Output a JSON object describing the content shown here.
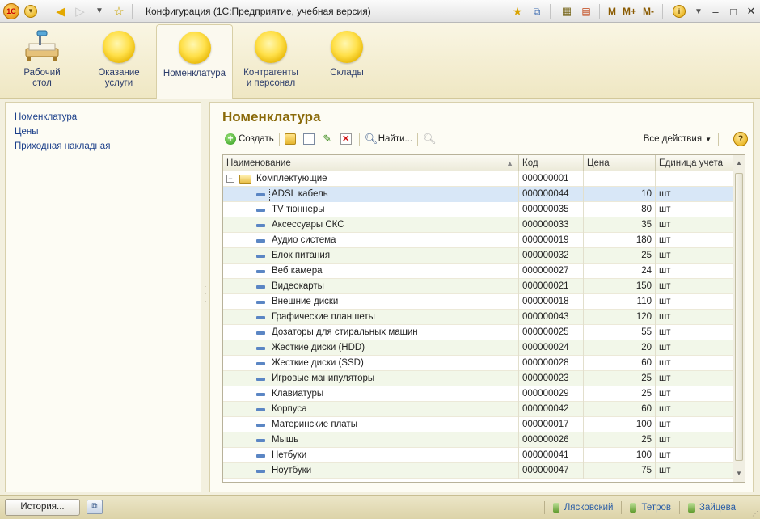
{
  "window": {
    "title": "Конфигурация  (1С:Предприятие, учебная версия)",
    "memory_buttons": [
      "M",
      "M+",
      "M-"
    ]
  },
  "sections": [
    {
      "label_line1": "Рабочий",
      "label_line2": "стол",
      "icon": "desktop-icon"
    },
    {
      "label_line1": "Оказание",
      "label_line2": "услуги",
      "icon": "section-icon"
    },
    {
      "label_line1": "Номенклатура",
      "label_line2": "",
      "icon": "section-icon",
      "active": true
    },
    {
      "label_line1": "Контрагенты",
      "label_line2": "и персонал",
      "icon": "section-icon"
    },
    {
      "label_line1": "Склады",
      "label_line2": "",
      "icon": "section-icon"
    }
  ],
  "leftnav": {
    "items": [
      "Номенклатура",
      "Цены",
      "Приходная накладная"
    ]
  },
  "main": {
    "title": "Номенклатура",
    "toolbar": {
      "create_label": "Создать",
      "find_label": "Найти...",
      "all_actions_label": "Все действия",
      "help_label": "?"
    },
    "columns": [
      "Наименование",
      "Код",
      "Цена",
      "Единица учета"
    ],
    "group_row": {
      "name": "Комплектующие",
      "code": "000000001",
      "price": "",
      "unit": ""
    },
    "rows": [
      {
        "name": "ADSL кабель",
        "code": "000000044",
        "price": "10",
        "unit": "шт"
      },
      {
        "name": "TV тюннеры",
        "code": "000000035",
        "price": "80",
        "unit": "шт"
      },
      {
        "name": "Аксессуары СКС",
        "code": "000000033",
        "price": "35",
        "unit": "шт"
      },
      {
        "name": "Аудио система",
        "code": "000000019",
        "price": "180",
        "unit": "шт"
      },
      {
        "name": "Блок питания",
        "code": "000000032",
        "price": "25",
        "unit": "шт"
      },
      {
        "name": "Веб камера",
        "code": "000000027",
        "price": "24",
        "unit": "шт"
      },
      {
        "name": "Видеокарты",
        "code": "000000021",
        "price": "150",
        "unit": "шт"
      },
      {
        "name": "Внешние диски",
        "code": "000000018",
        "price": "110",
        "unit": "шт"
      },
      {
        "name": "Графические планшеты",
        "code": "000000043",
        "price": "120",
        "unit": "шт"
      },
      {
        "name": "Дозаторы для стиральных машин",
        "code": "000000025",
        "price": "55",
        "unit": "шт"
      },
      {
        "name": "Жесткие диски (HDD)",
        "code": "000000024",
        "price": "20",
        "unit": "шт"
      },
      {
        "name": "Жесткие диски (SSD)",
        "code": "000000028",
        "price": "60",
        "unit": "шт"
      },
      {
        "name": "Игровые манипуляторы",
        "code": "000000023",
        "price": "25",
        "unit": "шт"
      },
      {
        "name": "Клавиатуры",
        "code": "000000029",
        "price": "25",
        "unit": "шт"
      },
      {
        "name": "Корпуса",
        "code": "000000042",
        "price": "60",
        "unit": "шт"
      },
      {
        "name": "Материнские платы",
        "code": "000000017",
        "price": "100",
        "unit": "шт"
      },
      {
        "name": "Мышь",
        "code": "000000026",
        "price": "25",
        "unit": "шт"
      },
      {
        "name": "Нетбуки",
        "code": "000000041",
        "price": "100",
        "unit": "шт"
      },
      {
        "name": "Ноутбуки",
        "code": "000000047",
        "price": "75",
        "unit": "шт"
      }
    ],
    "selected_row_index": 0
  },
  "statusbar": {
    "history_label": "История...",
    "users": [
      "Лясковский",
      "Тетров",
      "Зайцева"
    ]
  },
  "colors": {
    "accent_title": "#8a6a0a",
    "link": "#1b3f8a",
    "selected_row": "#d8e7f7"
  }
}
